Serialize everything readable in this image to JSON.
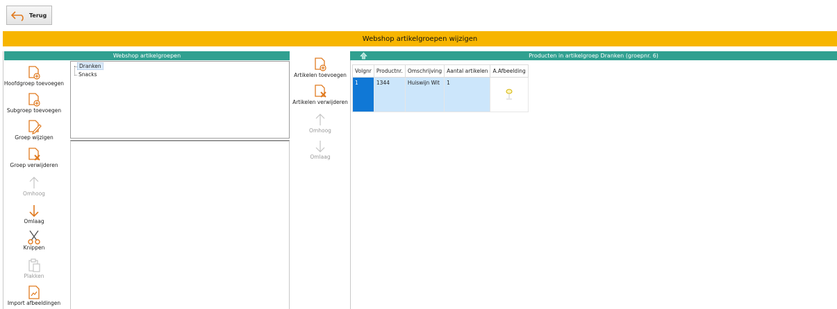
{
  "back_button": {
    "label": "Terug",
    "icon": "back-arrow-icon"
  },
  "title": "Webshop artikelgroepen wijzigen",
  "left_header": "Webshop artikelgroepen",
  "right_header": "Producten in artikelgroep Dranken (groepnr. 6)",
  "colors": {
    "accent": "#f7b500",
    "header": "#30a090",
    "icon_orange": "#e07a1f",
    "selection": "#1078d6",
    "row": "#cce6fb"
  },
  "left_tools": [
    {
      "label": "Hoofdgroep toevoegen",
      "icon": "add-document-icon",
      "enabled": true
    },
    {
      "label": "Subgroep toevoegen",
      "icon": "add-document-icon",
      "enabled": true
    },
    {
      "label": "Groep wijzigen",
      "icon": "edit-document-icon",
      "enabled": true
    },
    {
      "label": "Groep verwijderen",
      "icon": "delete-document-icon",
      "enabled": true
    },
    {
      "label": "Omhoog",
      "icon": "arrow-up-icon",
      "enabled": false
    },
    {
      "label": "Omlaag",
      "icon": "arrow-down-icon",
      "enabled": true
    },
    {
      "label": "Knippen",
      "icon": "scissors-icon",
      "enabled": true
    },
    {
      "label": "Plakken",
      "icon": "paste-icon",
      "enabled": false
    },
    {
      "label": "Import afbeeldingen",
      "icon": "image-document-icon",
      "enabled": true
    }
  ],
  "tree": {
    "items": [
      "Dranken",
      "Snacks"
    ],
    "selected": "Dranken"
  },
  "mid_tools": [
    {
      "label": "Artikelen toevoegen",
      "icon": "add-document-icon",
      "enabled": true
    },
    {
      "label": "Artikelen verwijderen",
      "icon": "delete-document-icon",
      "enabled": true
    },
    {
      "label": "Omhoog",
      "icon": "arrow-up-icon",
      "enabled": false
    },
    {
      "label": "Omlaag",
      "icon": "arrow-down-icon",
      "enabled": false
    }
  ],
  "table": {
    "columns": [
      "Volgnr",
      "Productnr.",
      "Omschrijving",
      "Aantal artikelen",
      "A.Afbeelding"
    ],
    "rows": [
      {
        "volgnr": "1",
        "productnr": "1344",
        "omschrijving": "Huiswijn Wit",
        "aantal": "1"
      }
    ]
  }
}
